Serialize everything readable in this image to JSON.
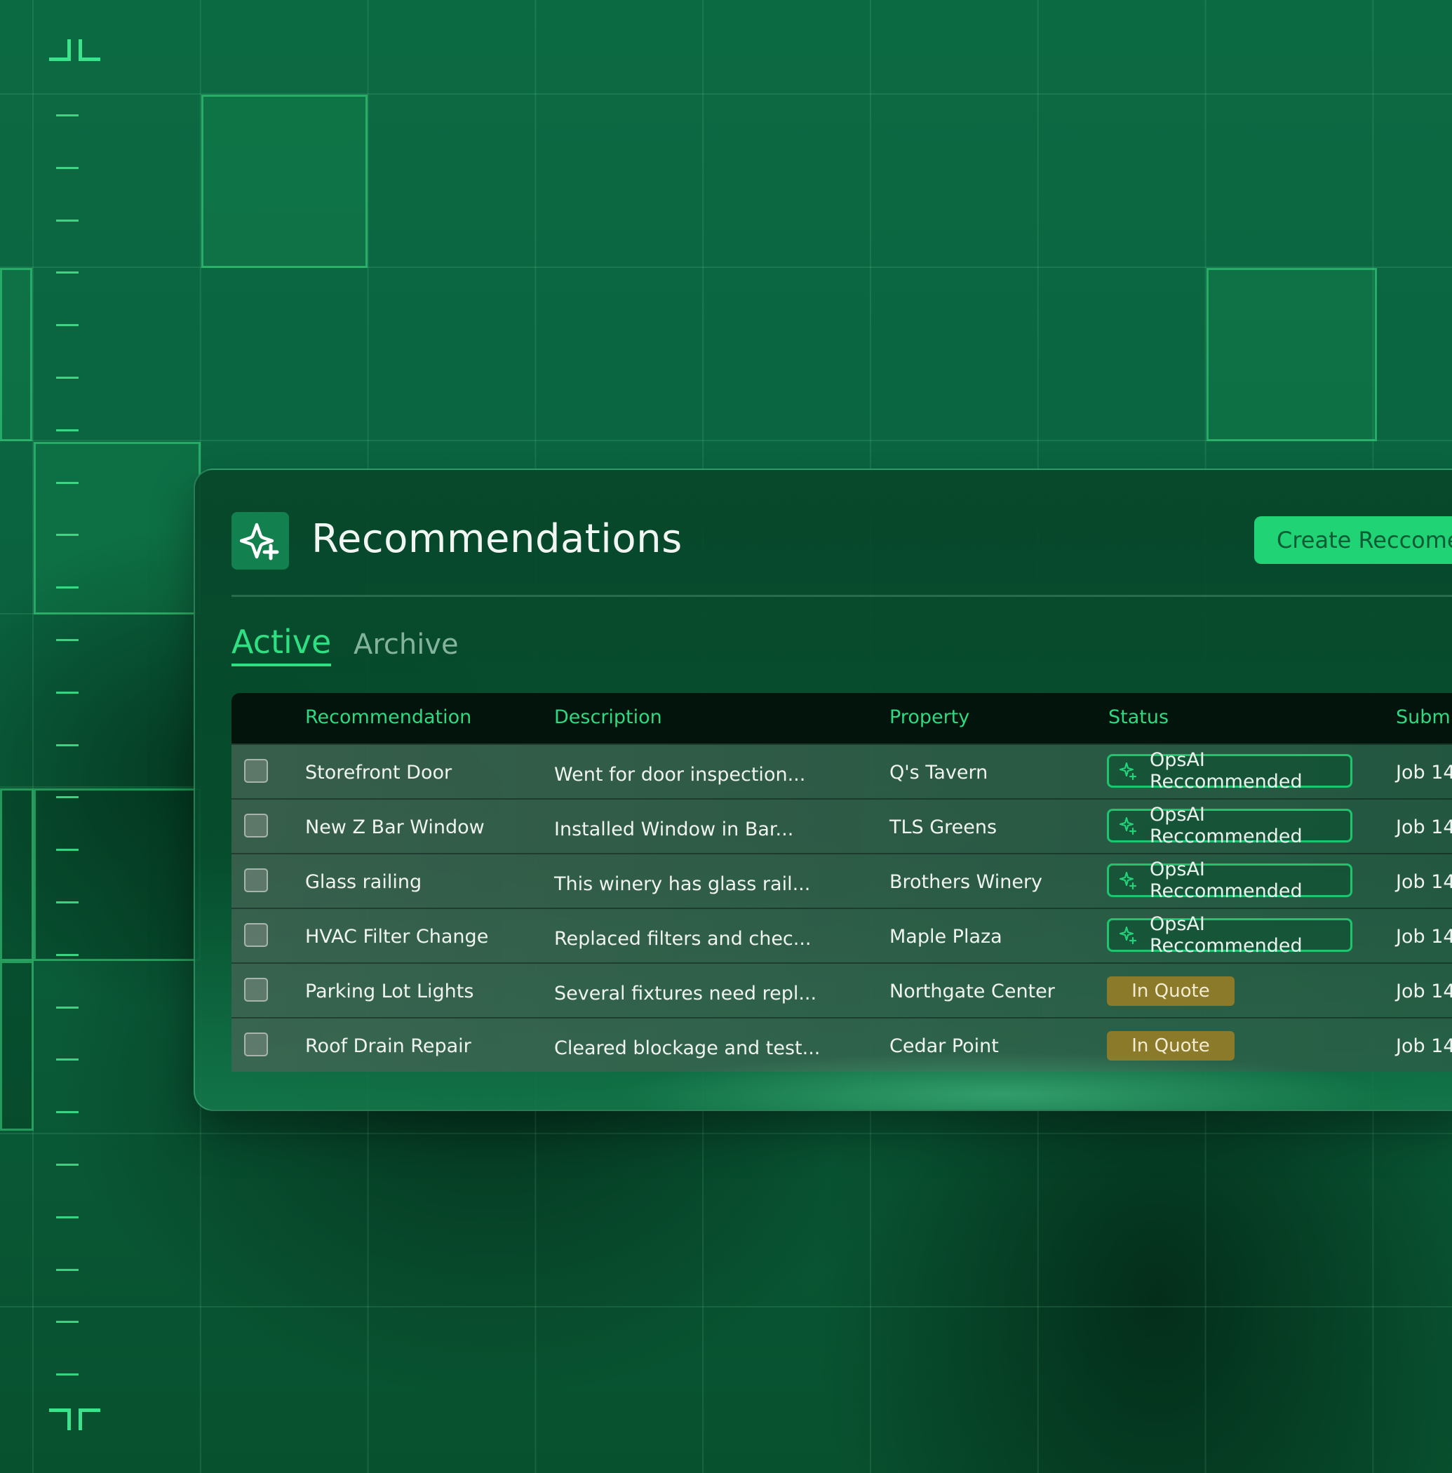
{
  "colors": {
    "accent": "#2fe083",
    "button": "#20d374",
    "quote_badge": "#8a7a2a",
    "background": "#0a5e3a"
  },
  "header": {
    "icon": "sparkle-plus-icon",
    "title": "Recommendations",
    "create_button": "Create Reccomendation"
  },
  "tabs": [
    {
      "label": "Active",
      "selected": true
    },
    {
      "label": "Archive",
      "selected": false
    }
  ],
  "table": {
    "columns": [
      "Recommendation",
      "Description",
      "Property",
      "Status",
      "Submi"
    ],
    "rows": [
      {
        "name": "Storefront Door",
        "description": "Went for door inspection...",
        "property": "Q's Tavern",
        "status": "OpsAI Reccommended",
        "status_type": "ai",
        "submission": "Job 14"
      },
      {
        "name": "New Z Bar Window",
        "description": "Installed Window in Bar...",
        "property": "TLS Greens",
        "status": "OpsAI Reccommended",
        "status_type": "ai",
        "submission": "Job 14"
      },
      {
        "name": "Glass railing",
        "description": "This winery has glass rail...",
        "property": "Brothers Winery",
        "status": "OpsAI Reccommended",
        "status_type": "ai",
        "submission": "Job 14"
      },
      {
        "name": "HVAC Filter Change",
        "description": "Replaced filters and chec...",
        "property": "Maple Plaza",
        "status": "OpsAI Reccommended",
        "status_type": "ai",
        "submission": "Job 14"
      },
      {
        "name": "Parking Lot Lights",
        "description": "Several fixtures need repl...",
        "property": "Northgate Center",
        "status": "In Quote",
        "status_type": "quote",
        "submission": "Job 14"
      },
      {
        "name": "Roof Drain Repair",
        "description": "Cleared blockage and test...",
        "property": "Cedar Point",
        "status": "In Quote",
        "status_type": "quote",
        "submission": "Job 14"
      }
    ]
  }
}
